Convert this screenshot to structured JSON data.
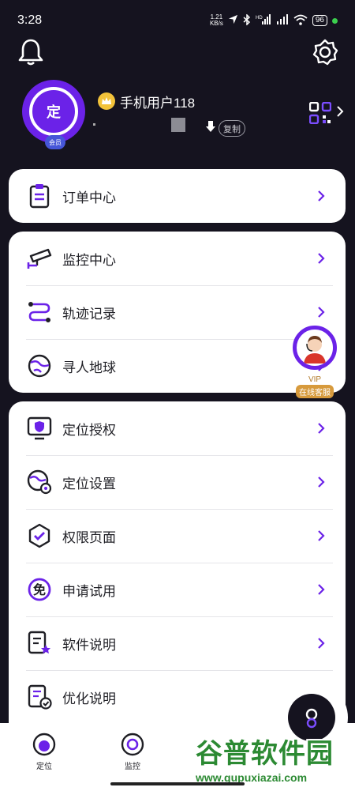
{
  "status_bar": {
    "time": "3:28",
    "net_speed_value": "1.21",
    "net_speed_unit": "KB/s",
    "signal_hd": "HD",
    "battery": "96"
  },
  "profile": {
    "avatar_text": "定",
    "member_badge": "会员",
    "username": "手机用户118",
    "copy_label": "复制"
  },
  "menu_card_1": [
    {
      "label": "订单中心",
      "icon": "clipboard-icon"
    }
  ],
  "menu_card_2": [
    {
      "label": "监控中心",
      "icon": "camera-icon"
    },
    {
      "label": "轨迹记录",
      "icon": "route-icon"
    },
    {
      "label": "寻人地球",
      "icon": "globe-icon"
    }
  ],
  "menu_card_3": [
    {
      "label": "定位授权",
      "icon": "shield-monitor-icon"
    },
    {
      "label": "定位设置",
      "icon": "globe-gear-icon"
    },
    {
      "label": "权限页面",
      "icon": "hexagon-check-icon"
    },
    {
      "label": "申请试用",
      "icon": "free-badge-icon"
    },
    {
      "label": "软件说明",
      "icon": "document-star-icon"
    },
    {
      "label": "优化说明",
      "icon": "document-check-icon"
    }
  ],
  "vip_service": {
    "title": "VIP",
    "subtitle": "在线客服"
  },
  "tabbar": {
    "tab_locate": "定位",
    "tab_monitor": "监控"
  },
  "watermark": {
    "title": "谷普软件园",
    "url": "www.gupuxiazai.com"
  },
  "colors": {
    "background": "#15131f",
    "accent": "#6b22e8",
    "card": "#ffffff",
    "crown": "#f3c33a"
  }
}
